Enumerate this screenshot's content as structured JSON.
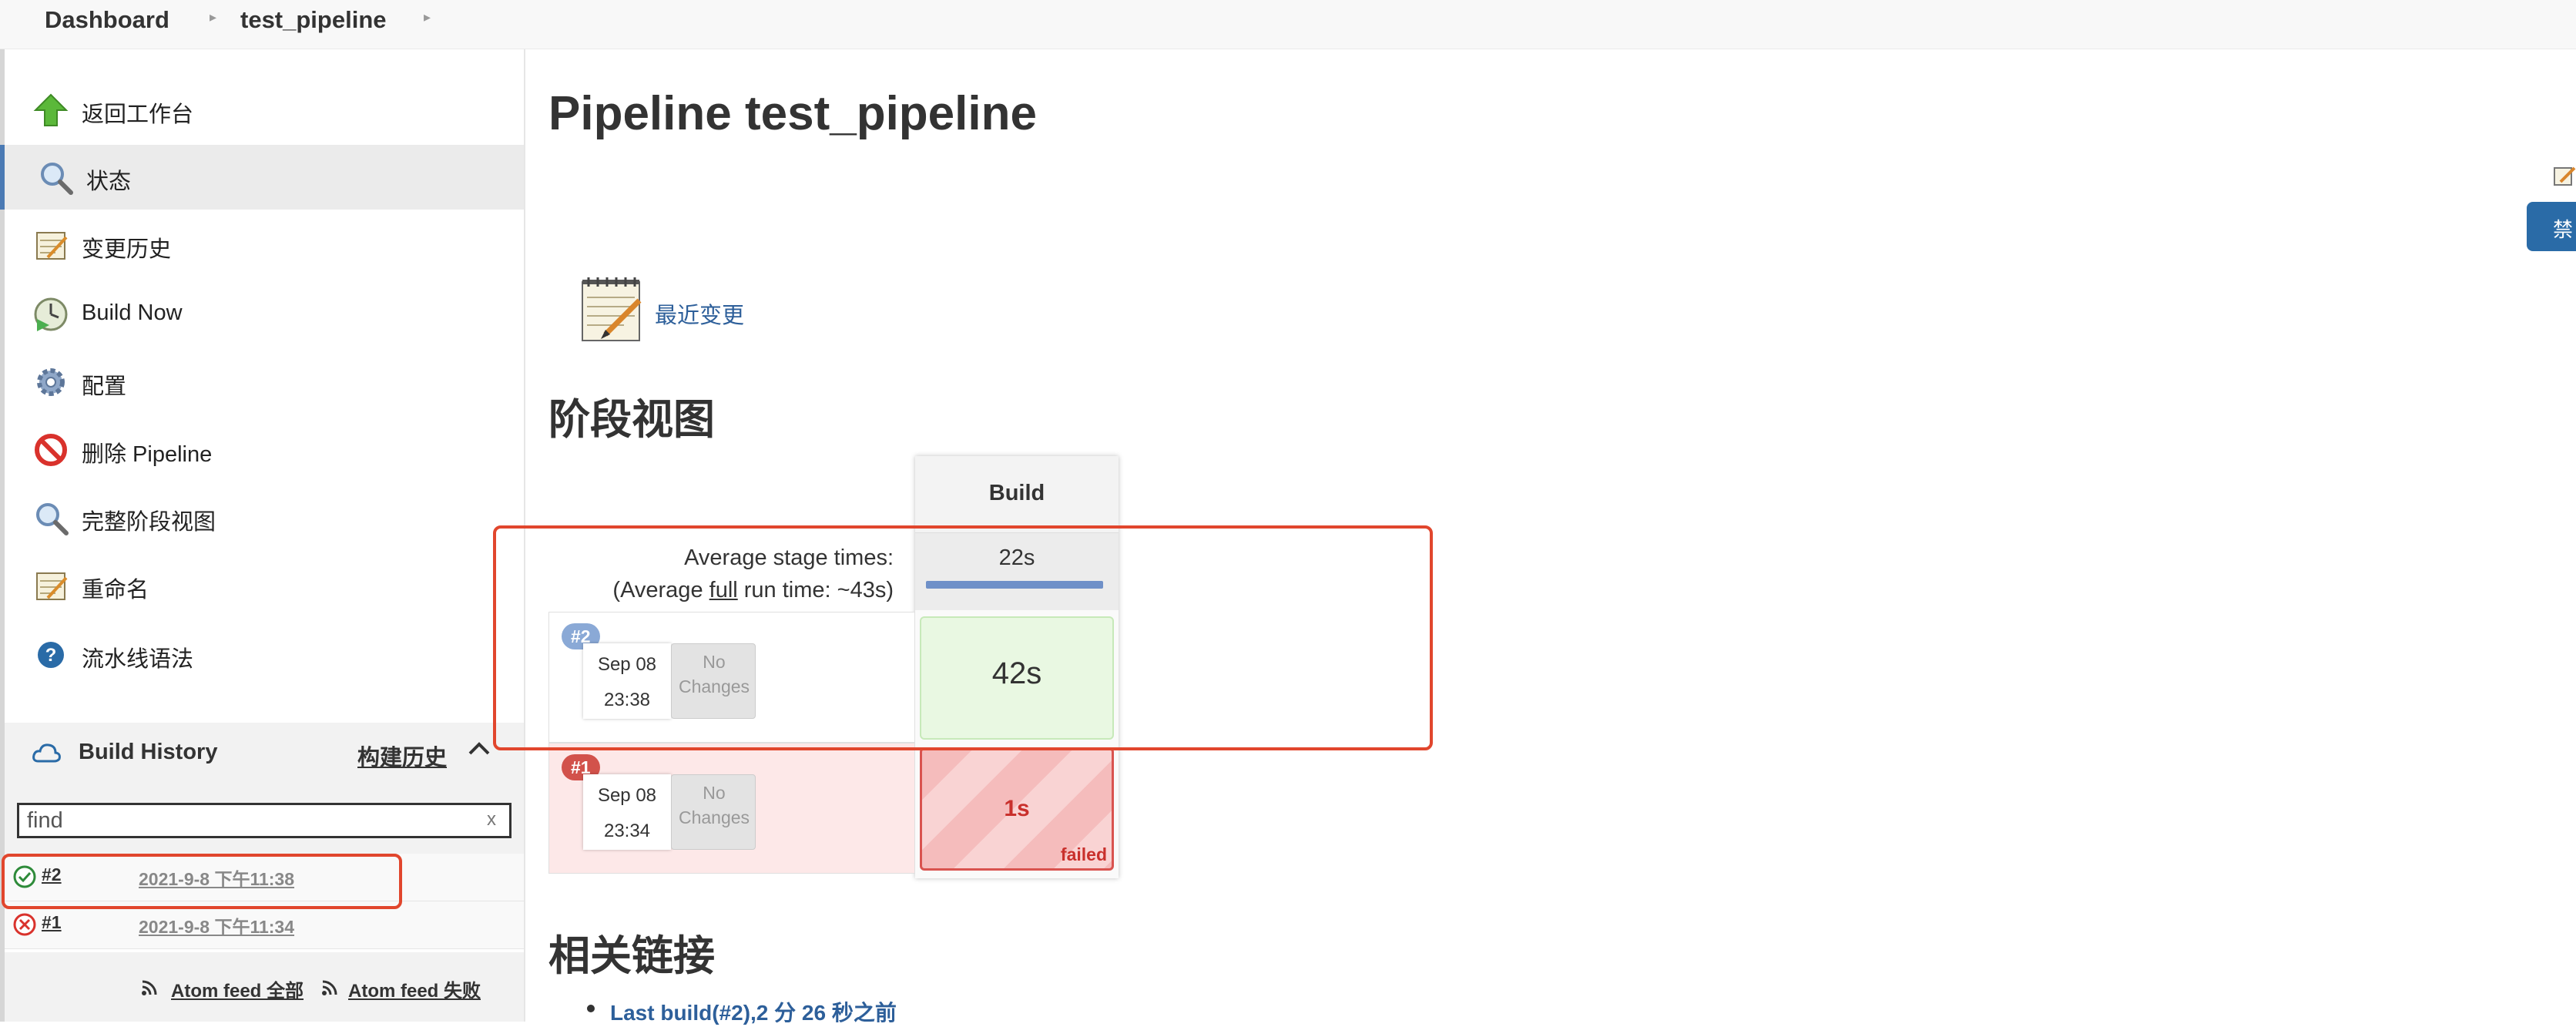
{
  "breadcrumb": {
    "items": [
      "Dashboard",
      "test_pipeline"
    ]
  },
  "sidebar": {
    "items": [
      {
        "label": "返回工作台",
        "icon": "up-arrow-icon"
      },
      {
        "label": "状态",
        "icon": "search-icon"
      },
      {
        "label": "变更历史",
        "icon": "notepad-icon"
      },
      {
        "label": "Build Now",
        "icon": "clock-play-icon"
      },
      {
        "label": "配置",
        "icon": "gear-icon"
      },
      {
        "label": "删除 Pipeline",
        "icon": "no-entry-icon"
      },
      {
        "label": "完整阶段视图",
        "icon": "search-icon"
      },
      {
        "label": "重命名",
        "icon": "notepad-icon"
      },
      {
        "label": "流水线语法",
        "icon": "help-icon"
      }
    ],
    "active_index": 1
  },
  "build_history": {
    "title": "Build History",
    "link": "构建历史",
    "search_value": "find",
    "search_clear": "x",
    "builds": [
      {
        "number": "#2",
        "date": "2021-9-8 下午11:38",
        "status": "success"
      },
      {
        "number": "#1",
        "date": "2021-9-8 下午11:34",
        "status": "failed"
      }
    ],
    "feeds": [
      "Atom feed 全部",
      "Atom feed 失败"
    ]
  },
  "main": {
    "title": "Pipeline test_pipeline",
    "recent_changes": "最近变更",
    "stage_view_heading": "阶段视图",
    "related_heading": "相关链接",
    "related_links": [
      "Last build(#2),2 分 26 秒之前"
    ]
  },
  "stage_view": {
    "stage_name": "Build",
    "avg_stage_label": "Average stage times:",
    "avg_full_prefix": "(Average ",
    "avg_full_link": "full",
    "avg_full_suffix": " run time: ~43s)",
    "avg_stage_time": "22s",
    "runs": [
      {
        "badge": "#2",
        "date": "Sep 08",
        "time": "23:38",
        "changes_l1": "No",
        "changes_l2": "Changes",
        "stage_time": "42s",
        "status": "success"
      },
      {
        "badge": "#1",
        "date": "Sep 08",
        "time": "23:34",
        "changes_l1": "No",
        "changes_l2": "Changes",
        "stage_time": "1s",
        "status": "failed",
        "status_label": "failed"
      }
    ]
  },
  "right_edge": {
    "disable_label": "禁"
  },
  "colors": {
    "accent": "#2d5f9a",
    "success_cell": "#e9f8e2",
    "failed_row": "#fde8e8",
    "failed_red": "#d9534f",
    "highlight": "#e1462d"
  }
}
